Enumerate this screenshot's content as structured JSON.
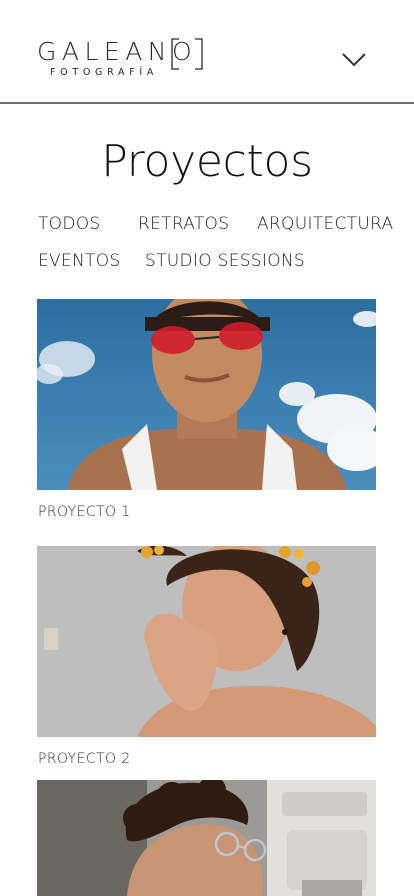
{
  "brand": {
    "name": "GALEANO",
    "subtitle": "FOTOGRAFÍA"
  },
  "header": {
    "menu_icon": "chevron-down-icon"
  },
  "page": {
    "title": "Proyectos"
  },
  "filters": [
    "TODOS",
    "RETRATOS",
    "ARQUITECTURA",
    "EVENTOS",
    "STUDIO SESSIONS"
  ],
  "projects": [
    {
      "label": "PROYECTO 1"
    },
    {
      "label": "PROYECTO 2"
    },
    {
      "label": ""
    }
  ],
  "colors": {
    "text": "#1a1a1a",
    "divider": "#6f6f6f",
    "background": "#ffffff"
  }
}
